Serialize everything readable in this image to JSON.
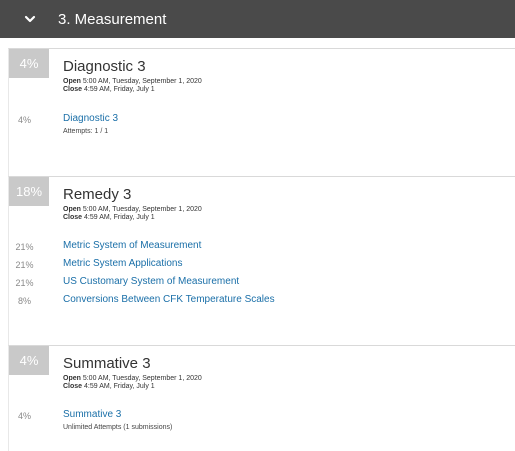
{
  "header": {
    "title": "3. Measurement",
    "icon": "chevron-down-icon"
  },
  "sections": [
    {
      "badge": "4%",
      "title": "Diagnostic 3",
      "open_label": "Open",
      "open_value": "5:00 AM, Tuesday, September 1, 2020",
      "close_label": "Close",
      "close_value": "4:59 AM, Friday, July 1",
      "items": [
        {
          "pct": "4%",
          "label": "Diagnostic 3",
          "sub": "Attempts: 1 / 1"
        }
      ]
    },
    {
      "badge": "18%",
      "title": "Remedy 3",
      "open_label": "Open",
      "open_value": "5:00 AM, Tuesday, September 1, 2020",
      "close_label": "Close",
      "close_value": "4:59 AM, Friday, July 1",
      "items": [
        {
          "pct": "21%",
          "label": "Metric System of Measurement"
        },
        {
          "pct": "21%",
          "label": "Metric System Applications"
        },
        {
          "pct": "21%",
          "label": "US Customary System of Measurement"
        },
        {
          "pct": "8%",
          "label": "Conversions Between CFK Temperature Scales"
        }
      ]
    },
    {
      "badge": "4%",
      "title": "Summative 3",
      "open_label": "Open",
      "open_value": "5:00 AM, Tuesday, September 1, 2020",
      "close_label": "Close",
      "close_value": "4:59 AM, Friday, July 1",
      "items": [
        {
          "pct": "4%",
          "label": "Summative 3",
          "sub": "Unlimited Attempts (1 submissions)"
        }
      ]
    }
  ]
}
